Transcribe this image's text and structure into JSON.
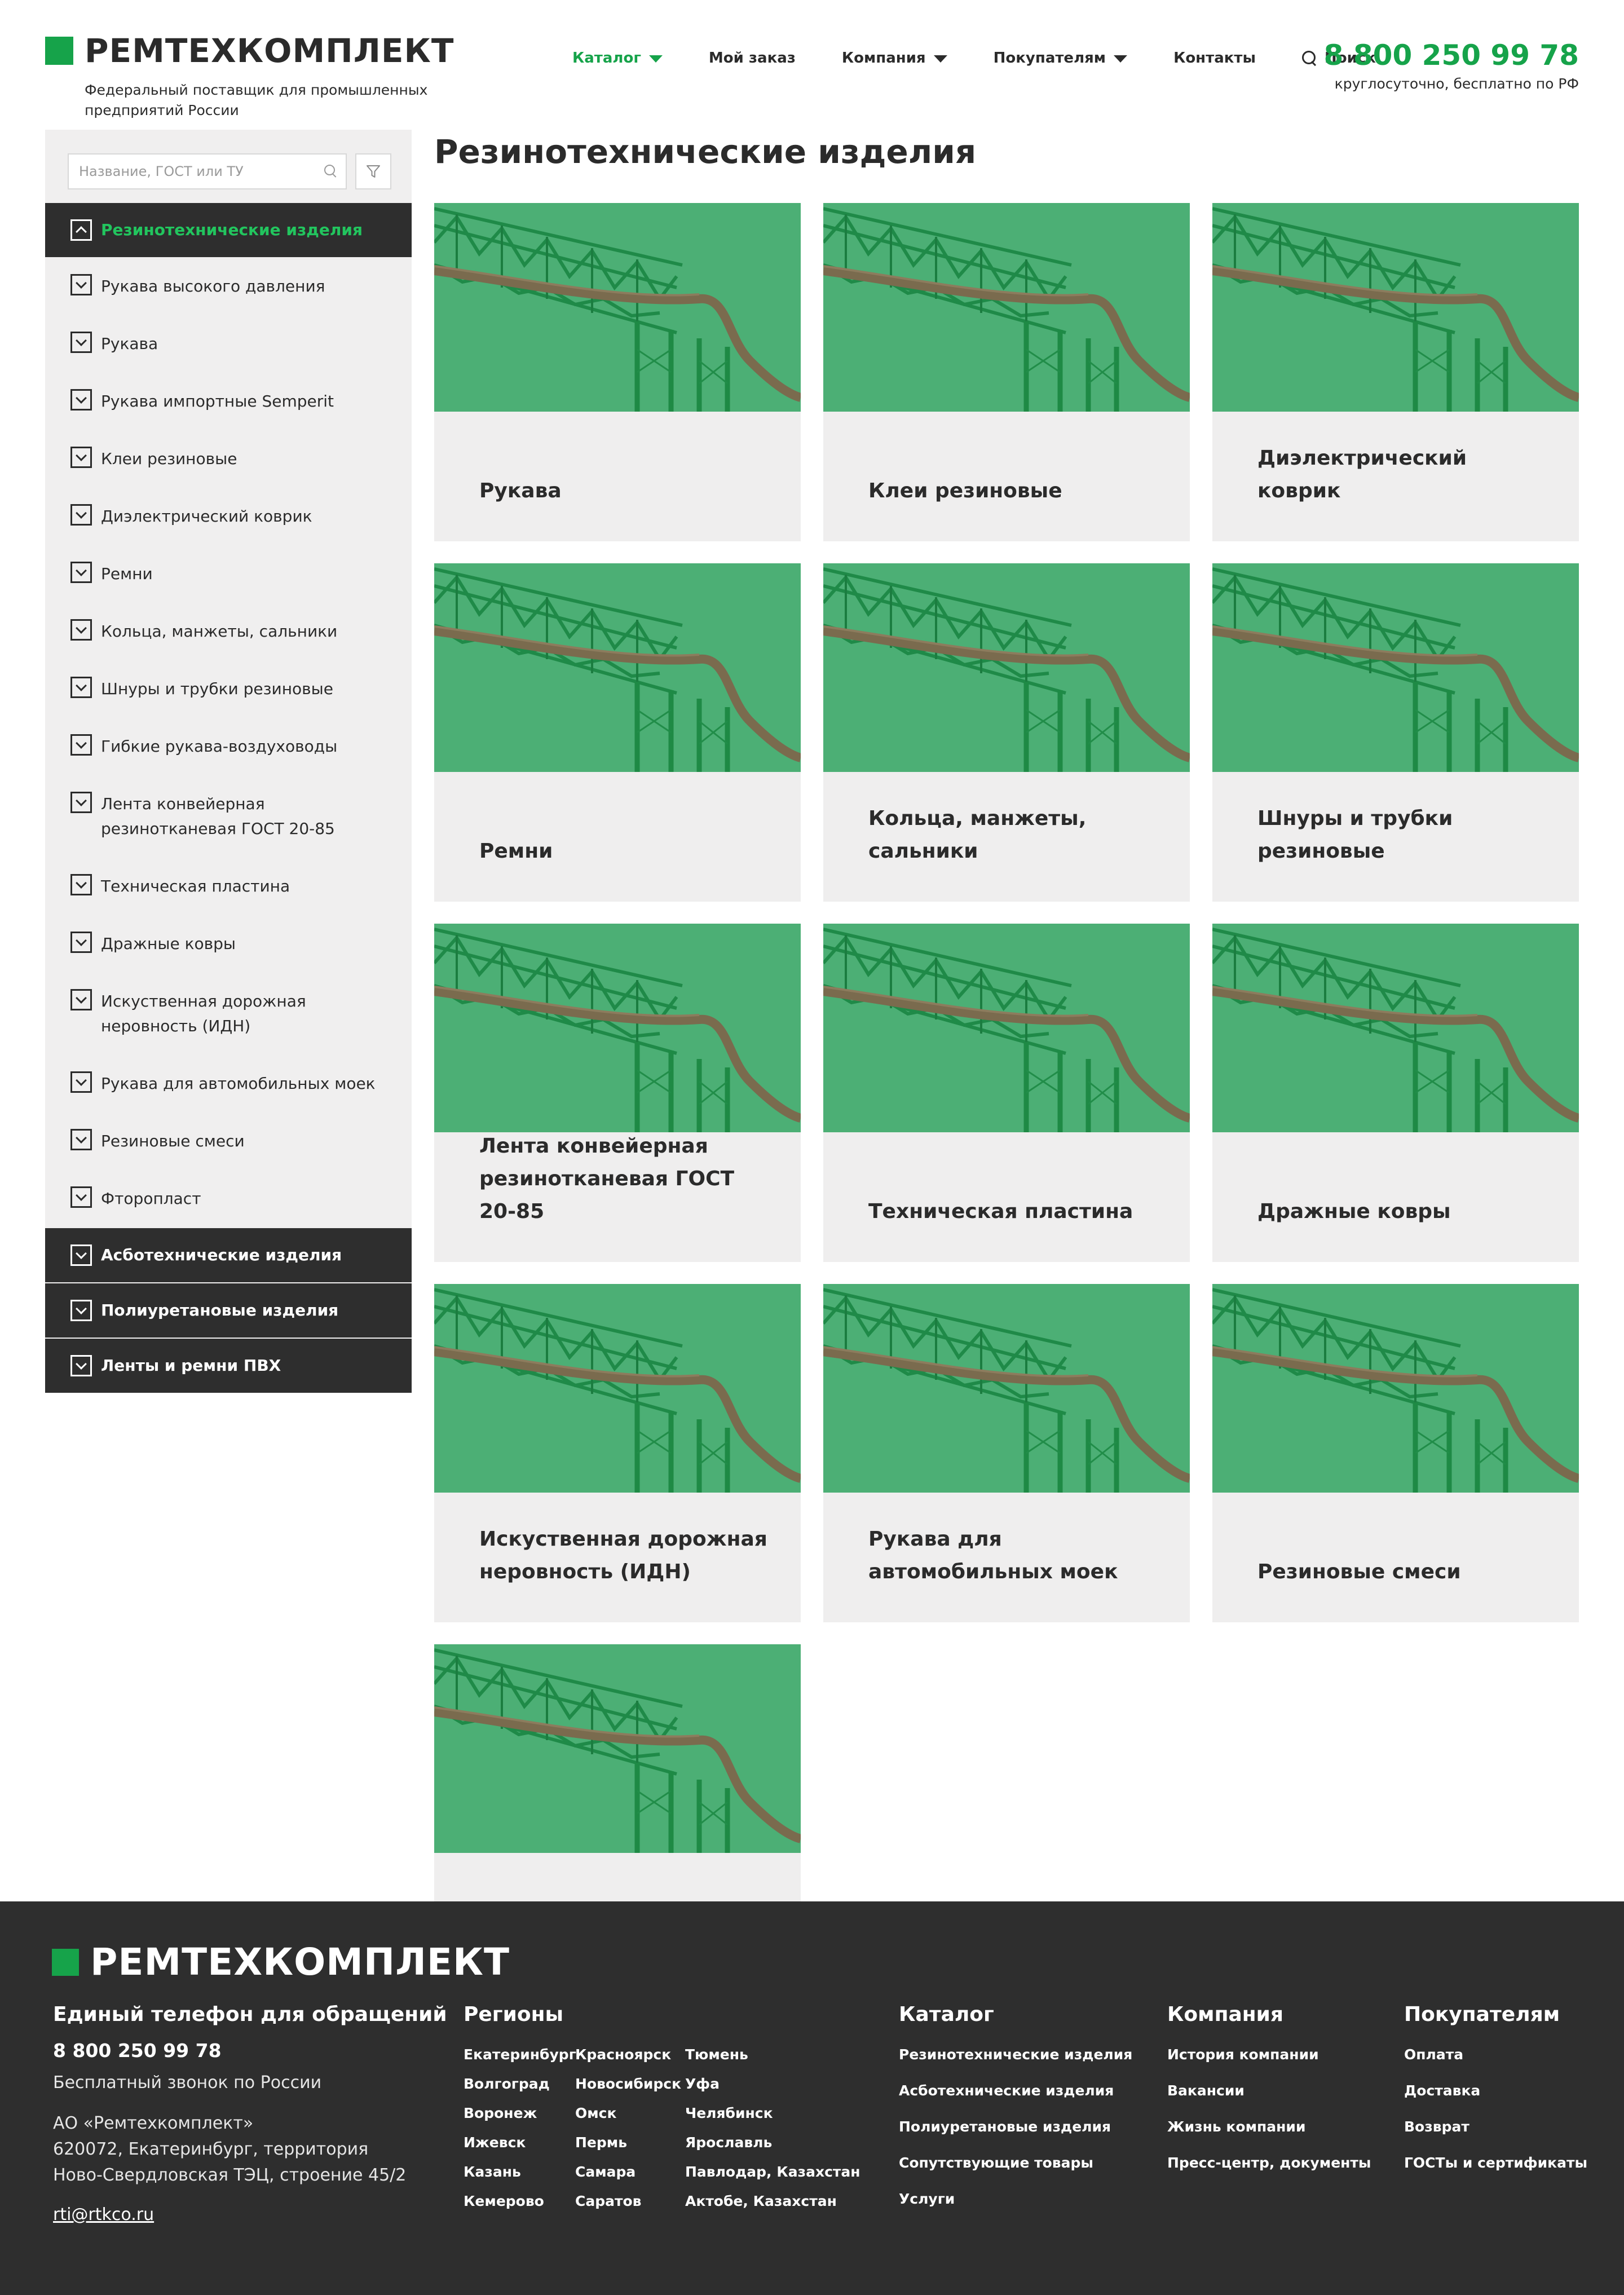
{
  "header": {
    "logo_text": "РЕМТЕХКОМПЛЕКТ",
    "tagline": "Федеральный поставщик для промышленных предприятий России",
    "nav": [
      {
        "label": "Каталог",
        "dropdown": true,
        "active": true
      },
      {
        "label": "Мой заказ",
        "dropdown": false
      },
      {
        "label": "Компания",
        "dropdown": true
      },
      {
        "label": "Покупателям",
        "dropdown": true
      },
      {
        "label": "Контакты",
        "dropdown": false
      },
      {
        "label": "Поиск",
        "icon": "search-icon"
      }
    ],
    "phone": "8 800 250 99 78",
    "phone_note": "круглосуточно, бесплатно по РФ"
  },
  "sidebar": {
    "search_placeholder": "Название, ГОСТ или ТУ",
    "filter_icon": "filter-icon",
    "categories": [
      {
        "label": "Резинотехнические изделия",
        "level": "top",
        "expanded": true,
        "active": true
      },
      {
        "label": "Рукава высокого давления",
        "level": "sub"
      },
      {
        "label": "Рукава",
        "level": "sub"
      },
      {
        "label": "Рукава импортные Semperit",
        "level": "sub"
      },
      {
        "label": "Клеи резиновые",
        "level": "sub"
      },
      {
        "label": "Диэлектрический коврик",
        "level": "sub"
      },
      {
        "label": "Ремни",
        "level": "sub"
      },
      {
        "label": "Кольца, манжеты, сальники",
        "level": "sub"
      },
      {
        "label": "Шнуры и трубки резиновые",
        "level": "sub"
      },
      {
        "label": "Гибкие рукава-воздуховоды",
        "level": "sub"
      },
      {
        "label": "Лента конвейерная резинотканевая ГОСТ 20-85",
        "level": "sub"
      },
      {
        "label": "Техническая пластина",
        "level": "sub"
      },
      {
        "label": "Дражные ковры",
        "level": "sub"
      },
      {
        "label": "Искуственная дорожная неровность (ИДН)",
        "level": "sub"
      },
      {
        "label": "Рукава для автомобильных моек",
        "level": "sub"
      },
      {
        "label": "Резиновые смеси",
        "level": "sub"
      },
      {
        "label": "Фторопласт",
        "level": "sub"
      },
      {
        "label": "Асботехнические изделия",
        "level": "top"
      },
      {
        "label": "Полиуретановые изделия",
        "level": "top"
      },
      {
        "label": "Ленты и ремни ПВХ",
        "level": "top"
      }
    ]
  },
  "main": {
    "title": "Резинотехнические изделия",
    "cards": [
      {
        "title": "Рукава"
      },
      {
        "title": "Клеи резиновые"
      },
      {
        "title": "Диэлектрический коврик"
      },
      {
        "title": "Ремни"
      },
      {
        "title": "Кольца, манжеты, сальники"
      },
      {
        "title": "Шнуры и трубки резиновые"
      },
      {
        "title": "Лента конвейерная резинотканевая ГОСТ 20-85"
      },
      {
        "title": "Техническая пластина"
      },
      {
        "title": "Дражные ковры"
      },
      {
        "title": "Искуственная дорожная неровность (ИДН)"
      },
      {
        "title": "Рукава для автомобильных моек"
      },
      {
        "title": "Резиновые смеси"
      },
      {
        "title": ""
      }
    ]
  },
  "footer": {
    "logo_text": "РЕМТЕХКОМПЛЕКТ",
    "contact_heading": "Единый телефон для обращений",
    "phone": "8 800 250 99 78",
    "phone_note": "Бесплатный звонок по России",
    "company": "АО «Ремтехкомплект»",
    "address_line1": "620072, Екатеринбург, территория",
    "address_line2": "Ново-Свердловская ТЭЦ, строение 45/2",
    "email": "rti@rtkco.ru",
    "regions_heading": "Регионы",
    "regions": [
      [
        "Екатеринбург",
        "Волгоград",
        "Воронеж",
        "Ижевск",
        "Казань",
        "Кемерово"
      ],
      [
        "Красноярск",
        "Новосибирск",
        "Омск",
        "Пермь",
        "Самара",
        "Саратов"
      ],
      [
        "Тюмень",
        "Уфа",
        "Челябинск",
        "Ярославль",
        "Павлодар, Казахстан",
        "Актобе, Казахстан"
      ]
    ],
    "catalog_heading": "Каталог",
    "catalog": [
      "Резинотехнические изделия",
      "Асботехнические изделия",
      "Полиуретановые изделия",
      "Сопутствующие товары",
      "Услуги"
    ],
    "company_heading": "Компания",
    "company_links": [
      "История компании",
      "Вакансии",
      "Жизнь компании",
      "Пресс-центр, документы"
    ],
    "buyers_heading": "Покупателям",
    "buyers_links": [
      "Оплата",
      "Доставка",
      "Возврат",
      "ГОСТы и сертификаты"
    ]
  },
  "colors": {
    "accent": "#16a34a",
    "card_image": "#4caf75",
    "dark": "#2e2e2e",
    "card_bg": "#efeeee"
  }
}
